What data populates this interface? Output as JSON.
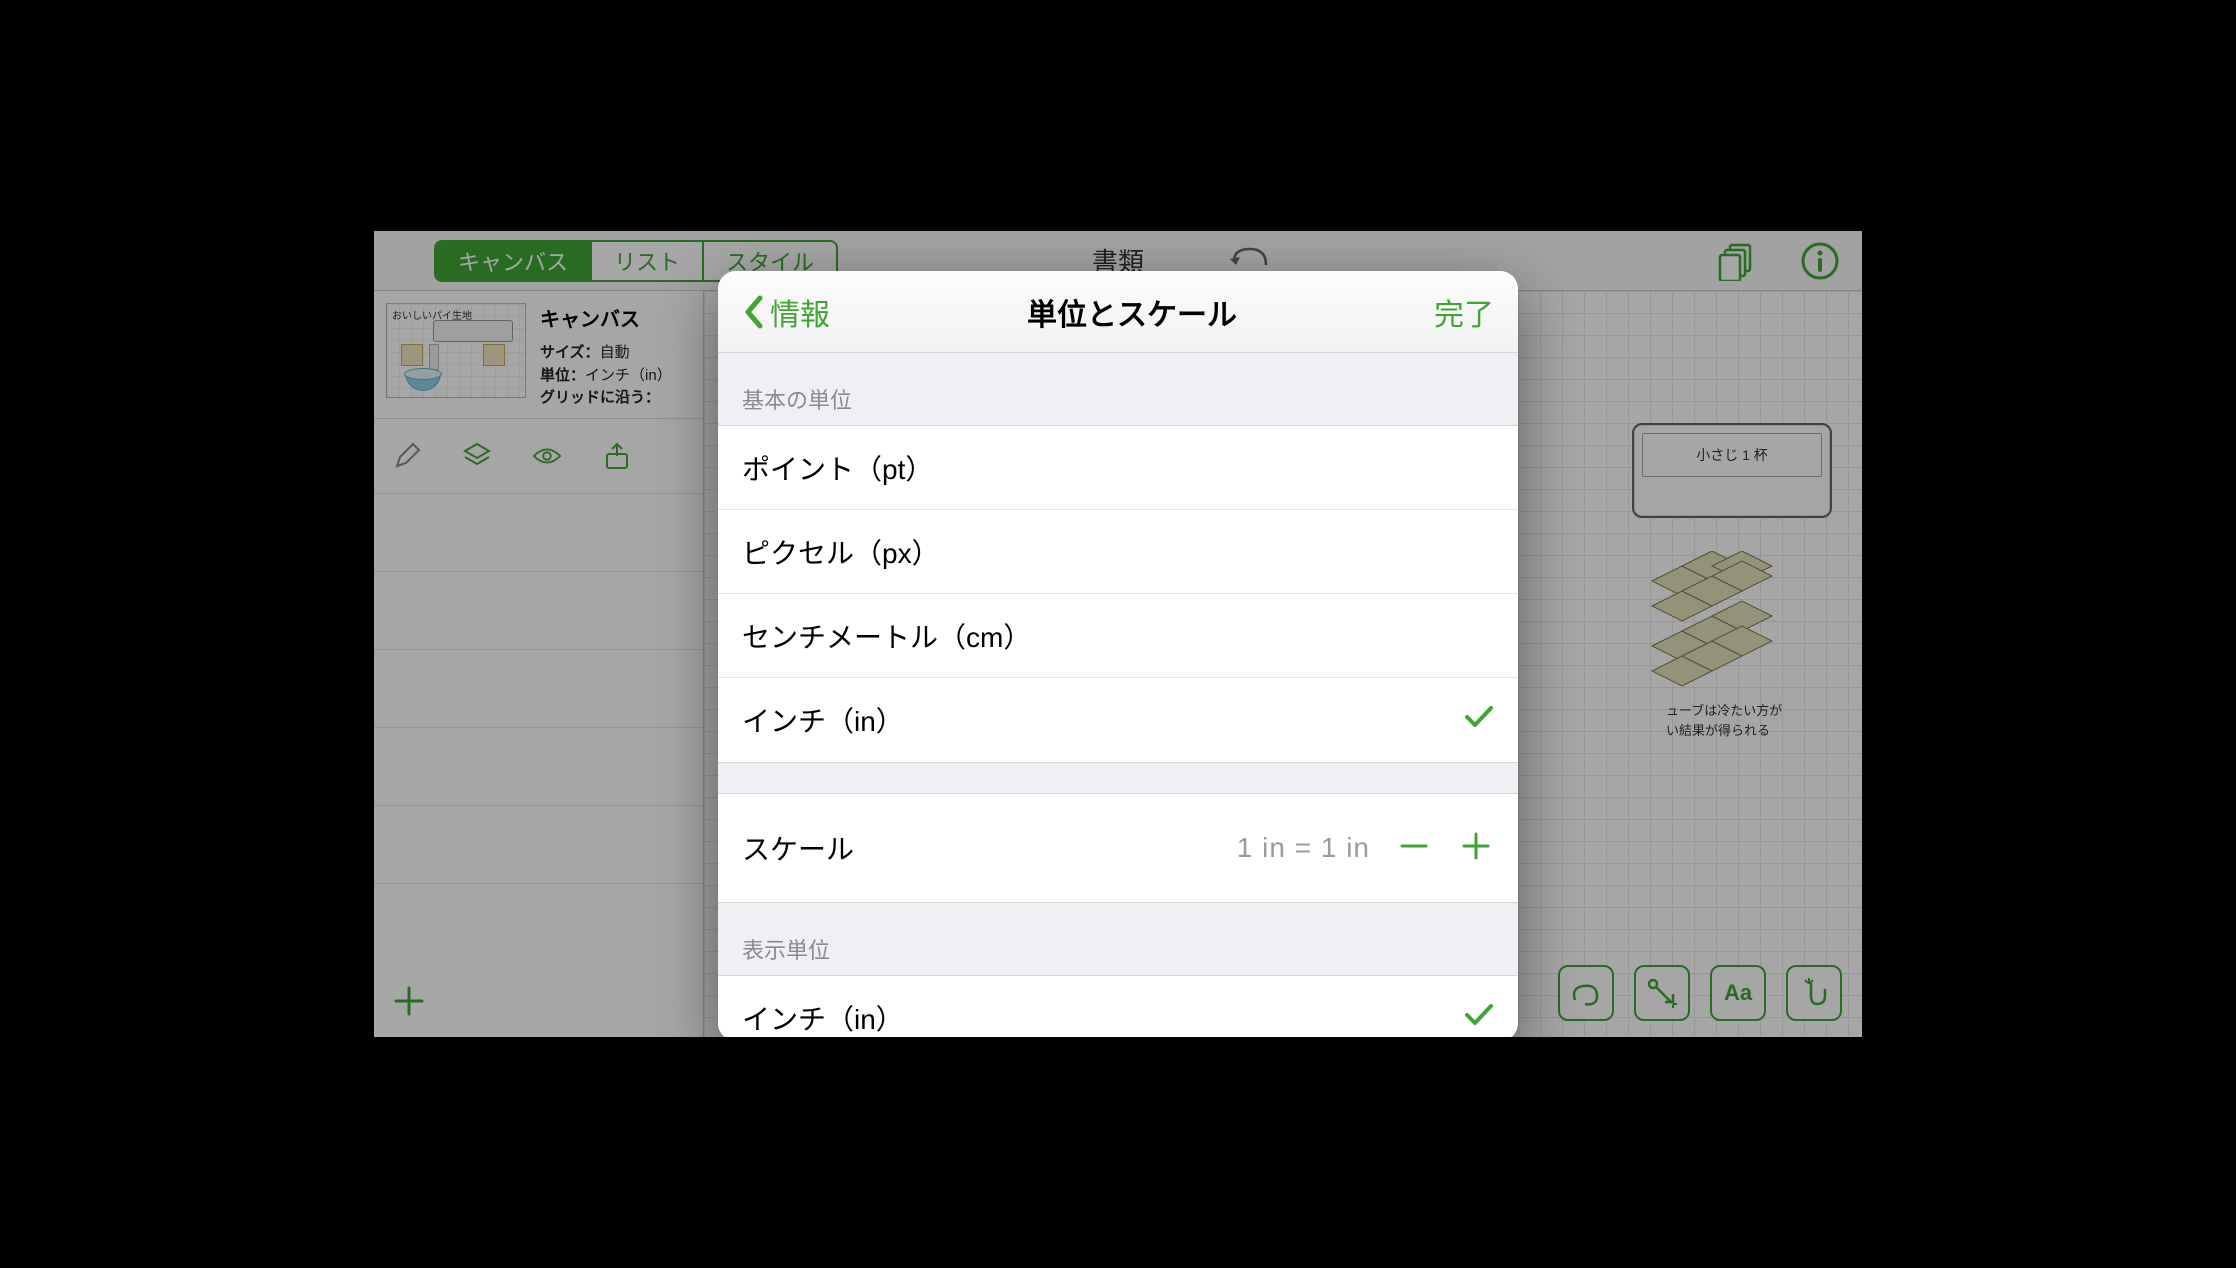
{
  "colors": {
    "accent": "#3fa535"
  },
  "toolbar": {
    "tabs": {
      "canvas": "キャンバス",
      "list": "リスト",
      "style": "スタイル"
    },
    "center_label": "書類",
    "pages_icon": "pages-icon",
    "info_icon": "info-icon"
  },
  "sidebar": {
    "canvas_title": "キャンバス",
    "thumb_title": "おいしいパイ生地",
    "meta": {
      "size_label": "サイズ：",
      "size_value": "自動",
      "unit_label": "単位：",
      "unit_value": "インチ（in）",
      "grid_label": "グリッドに沿う："
    }
  },
  "canvas": {
    "ingredient_label": "小さじ 1 杯",
    "note_line1": "ューブは冷たい方が",
    "note_line2": "い結果が得られる"
  },
  "bottom_tools": {
    "freeform": "freeform-icon",
    "arrow": "arrow-tool-icon",
    "text": "Aa",
    "touch": "touch-icon"
  },
  "popover": {
    "back_label": "情報",
    "title": "単位とスケール",
    "done_label": "完了",
    "sections": {
      "basic_unit_header": "基本の単位",
      "display_unit_header": "表示単位"
    },
    "units": [
      {
        "label": "ポイント（pt）",
        "selected": false
      },
      {
        "label": "ピクセル（px）",
        "selected": false
      },
      {
        "label": "センチメートル（cm）",
        "selected": false
      },
      {
        "label": "インチ（in）",
        "selected": true
      }
    ],
    "scale": {
      "label": "スケール",
      "value": "1 in = 1 in"
    },
    "display_units": [
      {
        "label": "インチ（in）",
        "selected": true
      }
    ]
  }
}
